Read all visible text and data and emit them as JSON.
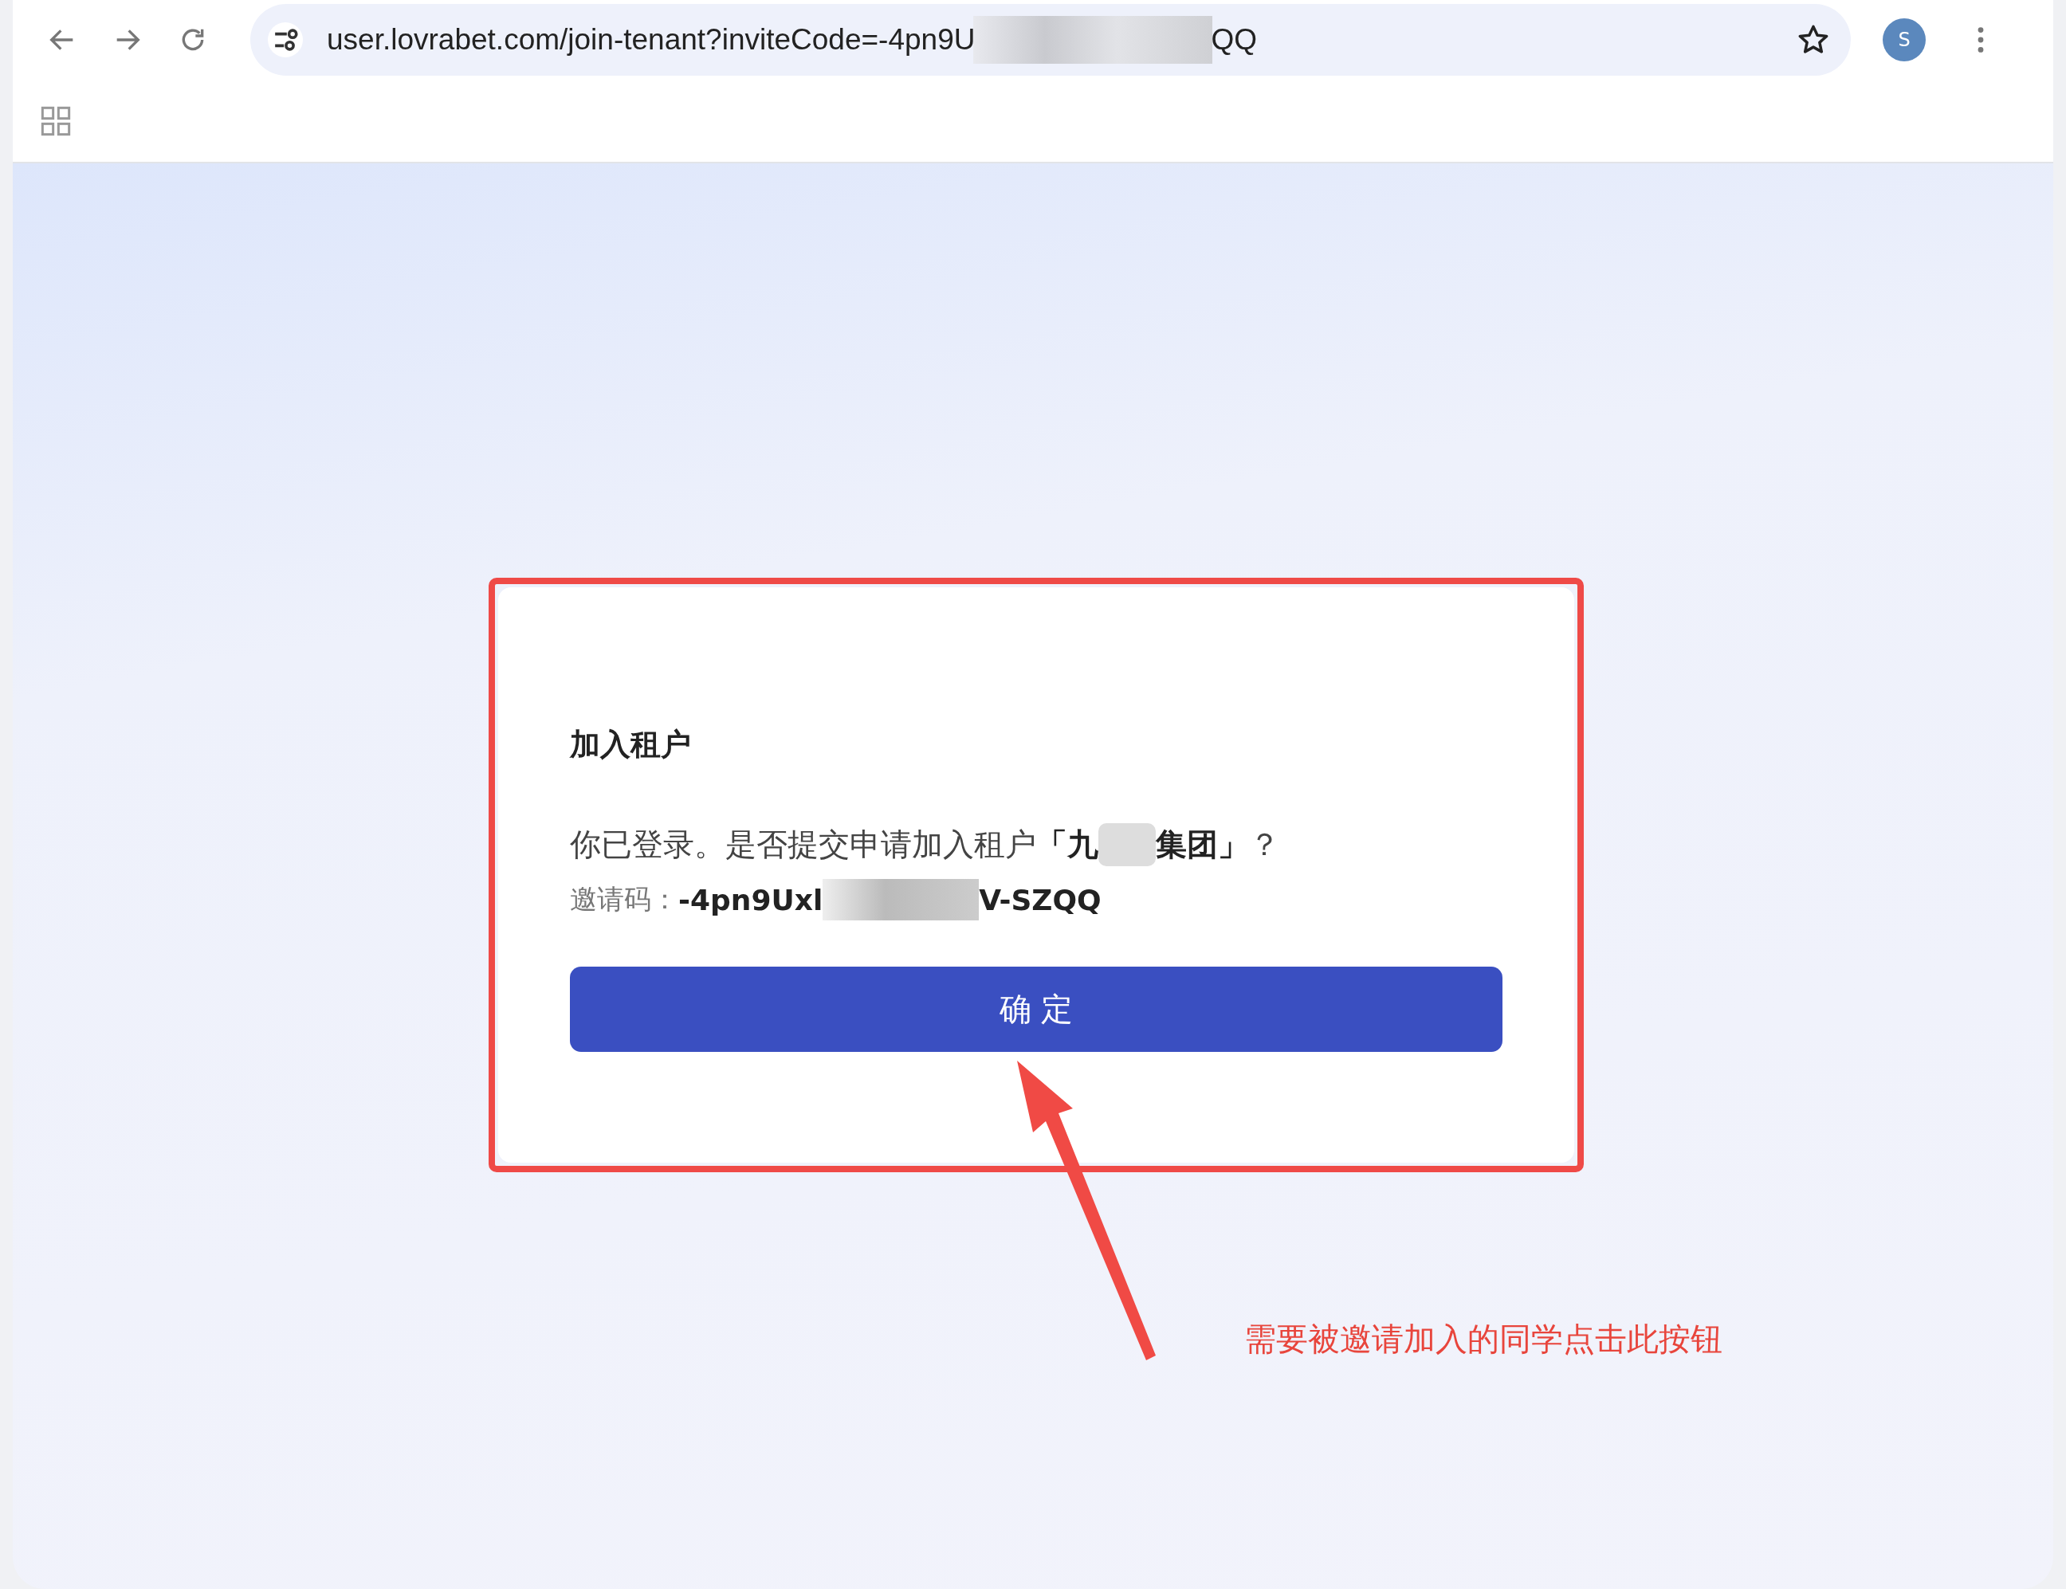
{
  "browser": {
    "url_start": "user.lovrabet.com/join-tenant?inviteCode=-4pn9U",
    "url_end": "QQ",
    "avatar": "S"
  },
  "dialog": {
    "title": "加入租户",
    "message": "你已登录。是否提交申请加入租户",
    "tenant_start": "「九",
    "tenant_end": "集团」",
    "question_mark": "？",
    "code_label": "邀请码：",
    "code_start": "-4pn9Uxl",
    "code_end": "V-SZQQ",
    "confirm_button": "确 定"
  },
  "annotation": {
    "text": "需要被邀请加入的同学点击此按钮"
  }
}
